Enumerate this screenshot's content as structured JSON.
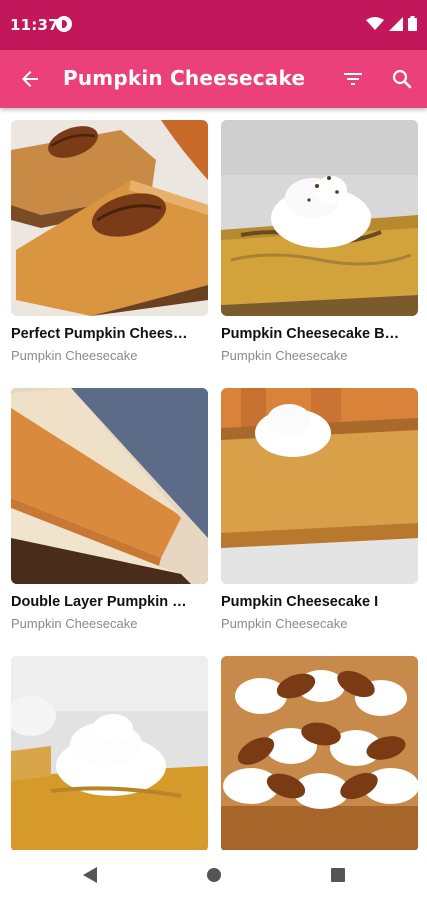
{
  "status": {
    "time": "11:37"
  },
  "appbar": {
    "title": "Pumpkin Cheesecake"
  },
  "recipes": [
    {
      "title": "Perfect Pumpkin Chees…",
      "subtitle": "Pumpkin Cheesecake"
    },
    {
      "title": "Pumpkin Cheesecake B…",
      "subtitle": "Pumpkin Cheesecake"
    },
    {
      "title": "Double Layer Pumpkin …",
      "subtitle": "Pumpkin Cheesecake"
    },
    {
      "title": "Pumpkin Cheesecake I",
      "subtitle": "Pumpkin Cheesecake"
    },
    {
      "title": "",
      "subtitle": ""
    },
    {
      "title": "",
      "subtitle": ""
    }
  ],
  "colors": {
    "status_bar": "#c2185b",
    "app_bar": "#ec407a"
  },
  "icons": [
    "back-arrow-icon",
    "filter-icon",
    "search-icon",
    "wifi-icon",
    "signal-icon",
    "battery-icon",
    "nav-back-icon",
    "nav-home-icon",
    "nav-recents-icon"
  ]
}
